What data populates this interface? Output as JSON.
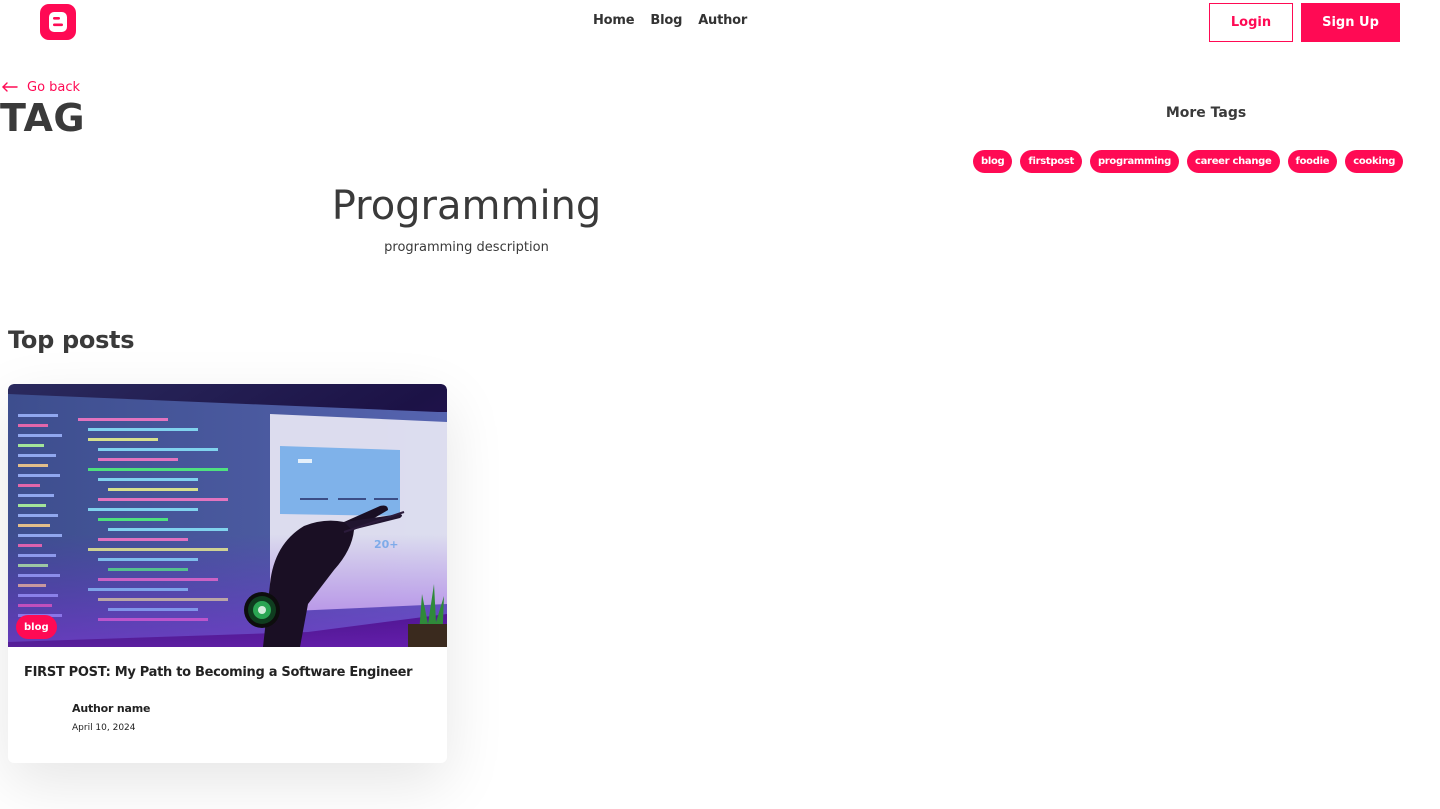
{
  "header": {
    "logo_icon": "blogger-logo-icon",
    "brand_color": "#ff0a54",
    "nav": [
      "Home",
      "Blog",
      "Author"
    ],
    "login_label": "Login",
    "signup_label": "Sign Up"
  },
  "page": {
    "go_back_label": "Go back",
    "go_back_icon": "arrow-left-icon",
    "heading": "TAG",
    "tag_title": "Programming",
    "tag_description": "programming description"
  },
  "more_tags": {
    "title": "More Tags",
    "tags": [
      "blog",
      "firstpost",
      "programming",
      "career change",
      "foodie",
      "cooking"
    ]
  },
  "top_posts": {
    "title": "Top posts",
    "posts": [
      {
        "badge": "blog",
        "title": "FIRST POST: My Path to Becoming a Software Engineer",
        "author_name": "Author name",
        "date": "April 10, 2024"
      }
    ]
  }
}
